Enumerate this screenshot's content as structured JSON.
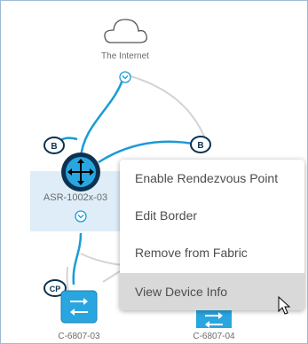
{
  "topology": {
    "internet_label": "The Internet",
    "nodes": [
      {
        "name": "ASR-1002x-03",
        "role_badge": "B"
      },
      {
        "name": "",
        "role_badge": "B"
      },
      {
        "name": "C-6807-03",
        "role_badge": "CP"
      },
      {
        "name": "C-6807-04",
        "role_badge": ""
      }
    ],
    "icons": {
      "cloud": "cloud-icon",
      "router": "router-icon",
      "switch": "switch-icon",
      "expand": "chevron-down-icon",
      "cursor": "mouse-pointer-icon"
    }
  },
  "context_menu": {
    "items": [
      {
        "label": "Enable Rendezvous Point"
      },
      {
        "label": "Edit Border"
      },
      {
        "label": "Remove from Fabric"
      },
      {
        "label": "View Device Info"
      }
    ],
    "hovered_index": 3
  },
  "colors": {
    "link_blue": "#1a9bd7",
    "link_gray": "#d4d4d4",
    "selection": "#deedf8",
    "device_fill": "#29a6e0",
    "router_fill": "#0b3250",
    "menu_hover": "#d9d9d9"
  }
}
